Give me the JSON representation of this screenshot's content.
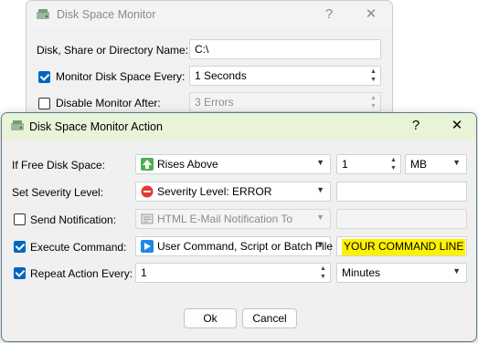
{
  "back_window": {
    "title": "Disk Space Monitor",
    "help_label": "?",
    "close_label": "✕",
    "path_label": "Disk, Share or Directory Name:",
    "path_value": "C:\\",
    "monitor_label": "Monitor Disk Space Every:",
    "monitor_value": "1 Seconds",
    "disable_label": "Disable Monitor After:",
    "disable_value": "3 Errors"
  },
  "front_window": {
    "title": "Disk Space Monitor Action",
    "help_label": "?",
    "close_label": "✕",
    "rows": {
      "free_space_label": "If Free Disk Space:",
      "free_space_condition": "Rises Above",
      "free_space_amount": "1",
      "free_space_unit": "MB",
      "severity_label": "Set Severity Level:",
      "severity_value": "Severity Level: ERROR",
      "notify_label": "Send Notification:",
      "notify_value": "HTML E-Mail Notification To",
      "execute_label": "Execute Command:",
      "execute_type": "User Command, Script or Batch File",
      "execute_command": "YOUR COMMAND LINE",
      "repeat_label": "Repeat Action Every:",
      "repeat_value": "1",
      "repeat_unit": "Minutes"
    },
    "ok_label": "Ok",
    "cancel_label": "Cancel"
  },
  "colors": {
    "accent": "#0067c0",
    "highlight": "#fff200",
    "title_tint": "#e9f3d8"
  }
}
